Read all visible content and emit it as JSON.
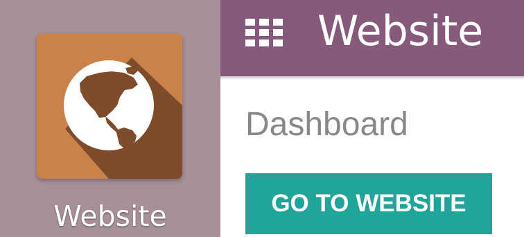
{
  "app_tile": {
    "label": "Website",
    "icon": "globe-icon",
    "tile_color": "#c9824a",
    "background_color": "#a79099"
  },
  "header": {
    "title": "Website",
    "menu_icon": "apps-grid-icon",
    "color": "#875a7b"
  },
  "breadcrumb": {
    "text": "Dashboard"
  },
  "actions": {
    "go_to_website_label": "GO TO WEBSITE",
    "button_color": "#21a49a"
  }
}
